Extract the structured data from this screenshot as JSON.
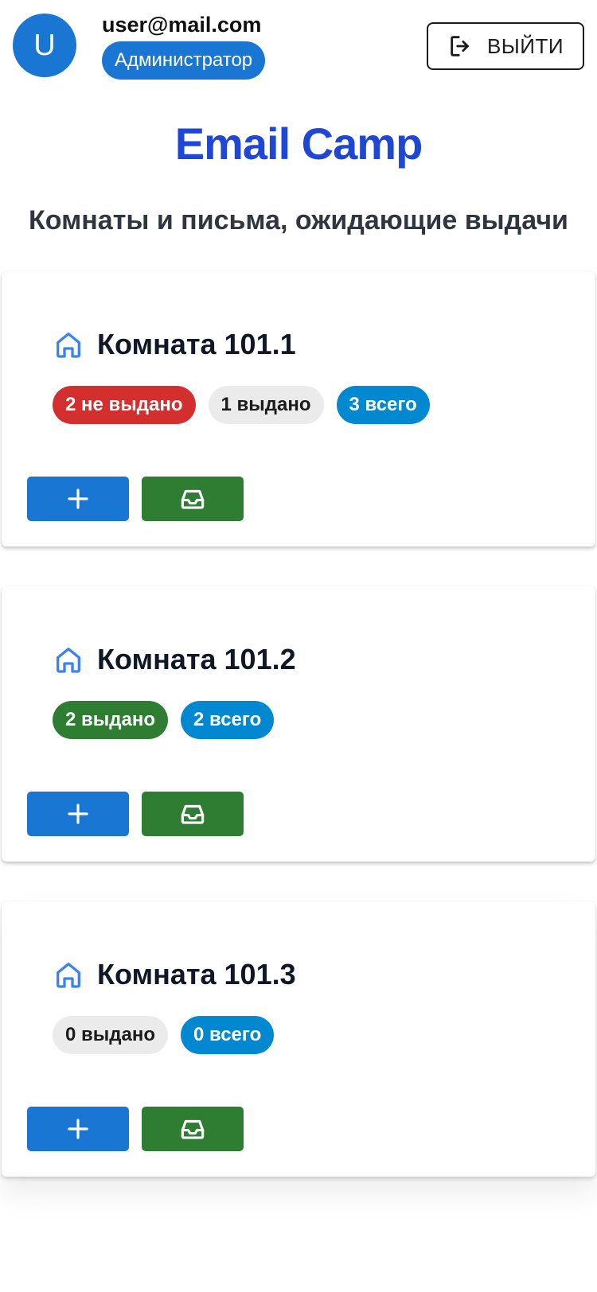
{
  "header": {
    "avatar_letter": "U",
    "user_email": "user@mail.com",
    "role": "Администратор",
    "logout_label": "ВЫЙТИ"
  },
  "app_title": "Email Camp",
  "subtitle": "Комнаты и письма, ожидающие выдачи",
  "rooms": [
    {
      "name": "Комната 101.1",
      "chips": [
        {
          "label": "2 не выдано",
          "variant": "red"
        },
        {
          "label": "1 выдано",
          "variant": "grey"
        },
        {
          "label": "3 всего",
          "variant": "blue"
        }
      ]
    },
    {
      "name": "Комната 101.2",
      "chips": [
        {
          "label": "2 выдано",
          "variant": "green"
        },
        {
          "label": "2 всего",
          "variant": "blue"
        }
      ]
    },
    {
      "name": "Комната 101.3",
      "chips": [
        {
          "label": "0 выдано",
          "variant": "grey"
        },
        {
          "label": "0 всего",
          "variant": "blue"
        }
      ]
    }
  ],
  "icons": {
    "logout": "logout-icon",
    "room": "home-icon",
    "add": "plus-icon",
    "issue": "inbox-icon"
  },
  "colors": {
    "primary": "#1976d2",
    "success": "#2e7d32",
    "error": "#d32f2f",
    "info": "#0288d1",
    "title": "#1f47d6"
  }
}
